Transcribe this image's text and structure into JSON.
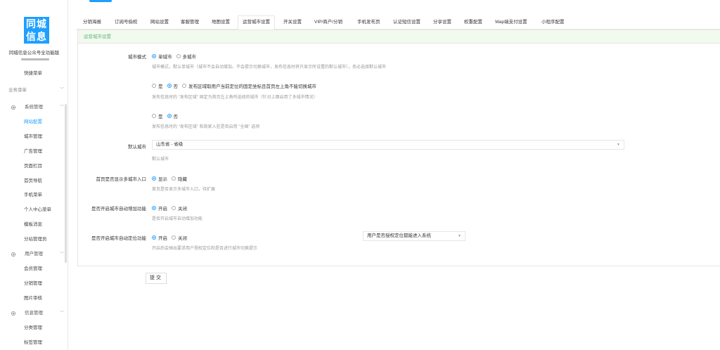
{
  "app": {
    "logo_line1": "同城",
    "logo_line2": "信息",
    "site_name": "同城信息公众号全功能版",
    "brand_color": "#1e9fff",
    "accent_green": "#5fb878"
  },
  "sidebar": {
    "quick_menu": "快捷菜单",
    "business_menu": "业务菜单",
    "groups": [
      {
        "label": "系统管理",
        "icon": "gear-icon",
        "items": [
          "网站配置",
          "城市管理",
          "广告管理",
          "页面栏目",
          "首页导航",
          "手机菜单",
          "个人中心菜单",
          "模板消息",
          "分站管理员"
        ],
        "active_item": "网站配置"
      },
      {
        "label": "用户管理",
        "icon": "gear-icon",
        "items": [
          "会员管理",
          "分销管理",
          "图片审核"
        ]
      },
      {
        "label": "信息管理",
        "icon": "gear-icon",
        "items": [
          "分类管理",
          "标签管理"
        ]
      }
    ]
  },
  "tabs": [
    "分销海报",
    "订阅号偷权",
    "网站设置",
    "客服管理",
    "地图设置",
    "运营城市设置",
    "开关设置",
    "VIP/商户/分销",
    "手机发布页",
    "认证短信设置",
    "分享设置",
    "权重配置",
    "Wap端支付设置",
    "小程序配置"
  ],
  "active_tab": "运营城市设置",
  "panel": {
    "title": "运营城市设置",
    "city_mode": {
      "label": "城市模式",
      "options": [
        "单城市",
        "多城市"
      ],
      "selected": "单城市",
      "help": "城市模式，默认单城市（城市不会自动增加、不会提示切换城市，发布信息时将只显示所设置的默认城市），务必选择默认城市"
    },
    "publish_area": {
      "options": [
        "是",
        "否",
        "发布区域取用户当前定位的固定坐标且首页左上角不能切换城市"
      ],
      "selected": "否",
      "help": "发布信息时的 \"发布区域\" 固定为首页左上角所选择的城市（针对上面启用了多城市情况）"
    },
    "all_country": {
      "options": [
        "是",
        "否"
      ],
      "selected": "否",
      "help": "发布信息时的 \"发布区域\" 和商家入驻是否启用 \"全国\" 选项"
    },
    "default_city": {
      "label": "默认城市",
      "value": "山东省 - 省级",
      "help": "默认城市"
    },
    "show_multi_entry": {
      "label": "首页是否显示多城市入口",
      "options": [
        "显示",
        "隐藏"
      ],
      "selected": "显示",
      "help": "首页是否显示多城市入口，待扩展"
    },
    "auto_add_city": {
      "label": "是否开启城市自动增加功能",
      "options": [
        "开启",
        "关闭"
      ],
      "selected": "开启",
      "help": "是否开启城市自动增加功能"
    },
    "auto_locate": {
      "label": "是否开启城市自动定位功能",
      "options": [
        "开启",
        "关闭"
      ],
      "selected": "开启",
      "help": "开启后会弹出要求用户授权定位和是否进行城市切换提示",
      "select_value": "用户是否授权定位都能进入系统"
    },
    "submit_label": "提交"
  }
}
